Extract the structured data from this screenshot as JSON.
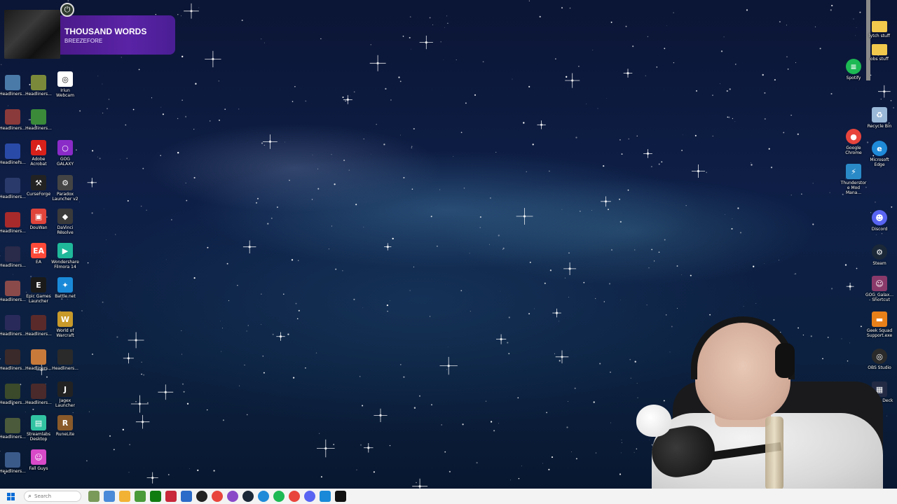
{
  "now_playing": {
    "title": "THOUSAND WORDS",
    "artist": "BREEZEFORE"
  },
  "desktop_left": [
    {
      "label": "Headliners...",
      "icon": "thumbnail-icon",
      "color": "#4a7aa8"
    },
    {
      "label": "Headliners...",
      "icon": "thumbnail-icon",
      "color": "#7a8a3a"
    },
    {
      "label": "Iriun Webcam",
      "icon": "webcam-icon",
      "color": "#ffffff"
    },
    {
      "label": "Headliners...",
      "icon": "thumbnail-icon",
      "color": "#8a3a3a"
    },
    {
      "label": "Headliners...",
      "icon": "thumbnail-icon",
      "color": "#3a8a3a"
    },
    {
      "label": "Headliners...",
      "icon": "thumbnail-icon",
      "color": "#2a4aa8"
    },
    {
      "label": "Adobe Acrobat",
      "icon": "acrobat-icon",
      "color": "#d8211b"
    },
    {
      "label": "GOG GALAXY",
      "icon": "gog-galaxy-icon",
      "color": "#8a2bc8"
    },
    {
      "label": "Headliners...",
      "icon": "thumbnail-icon",
      "color": "#2a3a6a"
    },
    {
      "label": "CurseForge",
      "icon": "curseforge-icon",
      "color": "#222222"
    },
    {
      "label": "Paradox Launcher v2",
      "icon": "paradox-icon",
      "color": "#444444"
    },
    {
      "label": "Headliners...",
      "icon": "thumbnail-icon",
      "color": "#a82a2a"
    },
    {
      "label": "DouWan",
      "icon": "douwan-icon",
      "color": "#e0443a"
    },
    {
      "label": "DaVinci Resolve",
      "icon": "davinci-icon",
      "color": "#3a3a3a"
    },
    {
      "label": "Headliners...",
      "icon": "thumbnail-icon",
      "color": "#2a2a4a"
    },
    {
      "label": "EA",
      "icon": "ea-icon",
      "color": "#ff4a3a"
    },
    {
      "label": "Wondershare Filmora 14",
      "icon": "filmora-icon",
      "color": "#1fb89a"
    },
    {
      "label": "Headliners...",
      "icon": "thumbnail-icon",
      "color": "#8a4a4a"
    },
    {
      "label": "Epic Games Launcher",
      "icon": "epic-games-icon",
      "color": "#1a1a1a"
    },
    {
      "label": "Battle.net",
      "icon": "battlenet-icon",
      "color": "#1a8ad8"
    },
    {
      "label": "Headliners...",
      "icon": "thumbnail-icon",
      "color": "#2a2a5a"
    },
    {
      "label": "Headliners...",
      "icon": "thumbnail-icon",
      "color": "#5a2a2a"
    },
    {
      "label": "World of Warcraft",
      "icon": "wow-icon",
      "color": "#c89a2a"
    },
    {
      "label": "Headliners...",
      "icon": "thumbnail-icon",
      "color": "#3a2a2a"
    },
    {
      "label": "Headliners...",
      "icon": "thumbnail-icon",
      "color": "#c87a3a"
    },
    {
      "label": "Headliners...",
      "icon": "thumbnail-icon",
      "color": "#2a2a2a"
    },
    {
      "label": "Headliners...",
      "icon": "thumbnail-icon",
      "color": "#3a4a2a"
    },
    {
      "label": "Headliners...",
      "icon": "thumbnail-icon",
      "color": "#4a2a2a"
    },
    {
      "label": "Jagex Launcher",
      "icon": "jagex-icon",
      "color": "#222222"
    },
    {
      "label": "Headliners...",
      "icon": "thumbnail-icon",
      "color": "#4a5a3a"
    },
    {
      "label": "Streamlabs Desktop",
      "icon": "streamlabs-icon",
      "color": "#31c3a2"
    },
    {
      "label": "RuneLite",
      "icon": "runelite-icon",
      "color": "#8a5a2a"
    },
    {
      "label": "Headliners...",
      "icon": "thumbnail-icon",
      "color": "#3a5a8a"
    },
    {
      "label": "Fall Guys",
      "icon": "fall-guys-icon",
      "color": "#d84ac8"
    }
  ],
  "desktop_right": [
    {
      "label": "lytch stuff",
      "icon": "folder-icon",
      "color": "#f2c94c"
    },
    {
      "label": "obs stuff",
      "icon": "folder-icon",
      "color": "#f2c94c"
    },
    {
      "label": "Spotify",
      "icon": "spotify-icon",
      "color": "#1db954"
    },
    {
      "label": "Recycle Bin",
      "icon": "recycle-bin-icon",
      "color": "#9ab8d8"
    },
    {
      "label": "Google Chrome",
      "icon": "chrome-icon",
      "color": "#e8453c"
    },
    {
      "label": "Microsoft Edge",
      "icon": "edge-icon",
      "color": "#1f8ad8"
    },
    {
      "label": "Thunderstore Mod Mana...",
      "icon": "thunderstore-icon",
      "color": "#2a8ac8"
    },
    {
      "label": "Discord",
      "icon": "discord-icon",
      "color": "#5865f2"
    },
    {
      "label": "Steam",
      "icon": "steam-icon",
      "color": "#1b2838"
    },
    {
      "label": "GOG_Galax... - Shortcut",
      "icon": "gog-shortcut-icon",
      "color": "#8a3a6a"
    },
    {
      "label": "Geek Squad Support.exe",
      "icon": "geek-squad-icon",
      "color": "#e8801a"
    },
    {
      "label": "OBS Studio",
      "icon": "obs-icon",
      "color": "#2a2a2a"
    },
    {
      "label": "Stream Deck",
      "icon": "stream-deck-icon",
      "color": "#222a44"
    }
  ],
  "taskbar": {
    "search_placeholder": "Search",
    "apps": [
      {
        "icon": "gamepad-icon",
        "color": "#7a9a5a"
      },
      {
        "icon": "copilot-icon",
        "color": "#4a8ad8"
      },
      {
        "icon": "file-explorer-icon",
        "color": "#f2b234"
      },
      {
        "icon": "minecraft-icon",
        "color": "#4a9a3a"
      },
      {
        "icon": "xbox-icon",
        "color": "#107c10"
      },
      {
        "icon": "app-red-icon",
        "color": "#c8283a"
      },
      {
        "icon": "app-blue-icon",
        "color": "#2a6ac8"
      },
      {
        "icon": "obs-icon",
        "color": "#222222"
      },
      {
        "icon": "chrome-icon",
        "color": "#e8453c"
      },
      {
        "icon": "gog-icon",
        "color": "#8a4ac8"
      },
      {
        "icon": "steam-icon",
        "color": "#1b2838"
      },
      {
        "icon": "edge-icon",
        "color": "#1f8ad8"
      },
      {
        "icon": "spotify-icon",
        "color": "#1db954"
      },
      {
        "icon": "chrome-icon",
        "color": "#e8453c"
      },
      {
        "icon": "discord-icon",
        "color": "#5865f2"
      },
      {
        "icon": "battlenet-icon",
        "color": "#1a8ad8"
      },
      {
        "icon": "capcut-icon",
        "color": "#111111"
      }
    ]
  }
}
